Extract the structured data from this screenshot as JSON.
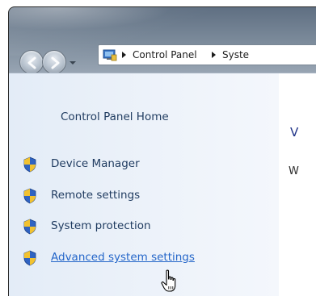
{
  "address_bar": {
    "crumbs": [
      "Control Panel",
      "Syste"
    ]
  },
  "left_pane": {
    "home_link": "Control Panel Home",
    "tasks": [
      {
        "label": "Device Manager",
        "icon": "uac-shield-icon"
      },
      {
        "label": "Remote settings",
        "icon": "uac-shield-icon"
      },
      {
        "label": "System protection",
        "icon": "uac-shield-icon"
      },
      {
        "label": "Advanced system settings",
        "icon": "uac-shield-icon",
        "hovered": true
      }
    ]
  },
  "right_pane": {
    "heading_initial": "V",
    "text_initial": "W"
  },
  "colors": {
    "link": "#1e3a5f",
    "link_hover": "#2466c9",
    "pane_bg": "#e3ecf7"
  }
}
